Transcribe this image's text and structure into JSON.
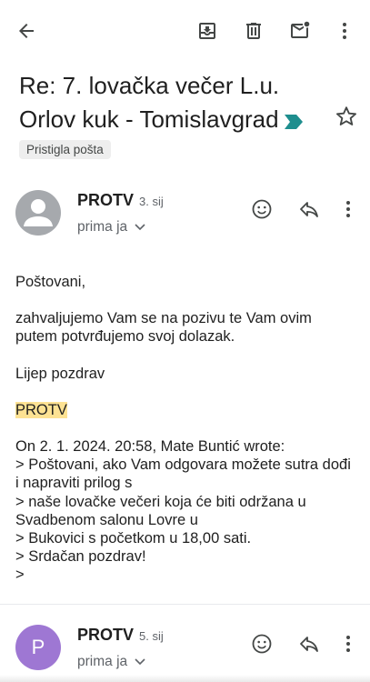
{
  "toolbar": {
    "icons": [
      "back-arrow-icon",
      "archive-icon",
      "delete-icon",
      "mark-unread-icon",
      "more-vert-icon"
    ]
  },
  "subject": {
    "title": "Re: 7. lovačka večer L.u. Orlov kuk - Tomislavgrad",
    "label": "Pristigla pošta",
    "importance_color": "#1e8e8e"
  },
  "messages": [
    {
      "sender": "PROTV",
      "date": "3. sij",
      "to": "prima ja",
      "avatar_letter": "",
      "avatar_color": "#a6a9ad"
    },
    {
      "sender": "PROTV",
      "date": "5. sij",
      "to": "prima ja",
      "avatar_letter": "P",
      "avatar_color": "#9e77d3"
    }
  ],
  "body": {
    "greeting": "Poštovani,",
    "line1": "zahvaljujemo Vam se na pozivu te Vam ovim putem potvrđujemo svoj dolazak.",
    "closing": "Lijep pozdrav",
    "signature": "PROTV",
    "quote_header": "On 2. 1. 2024. 20:58, Mate Buntić wrote:",
    "quote_lines": [
      "> Poštovani, ako Vam odgovara možete sutra dođi i napraviti prilog s",
      "> naše lovačke večeri koja će biti održana u Svadbenom salonu Lovre u",
      "> Bukovici s početkom u 18,00 sati.",
      "> Srdačan pozdrav!",
      ">"
    ]
  }
}
